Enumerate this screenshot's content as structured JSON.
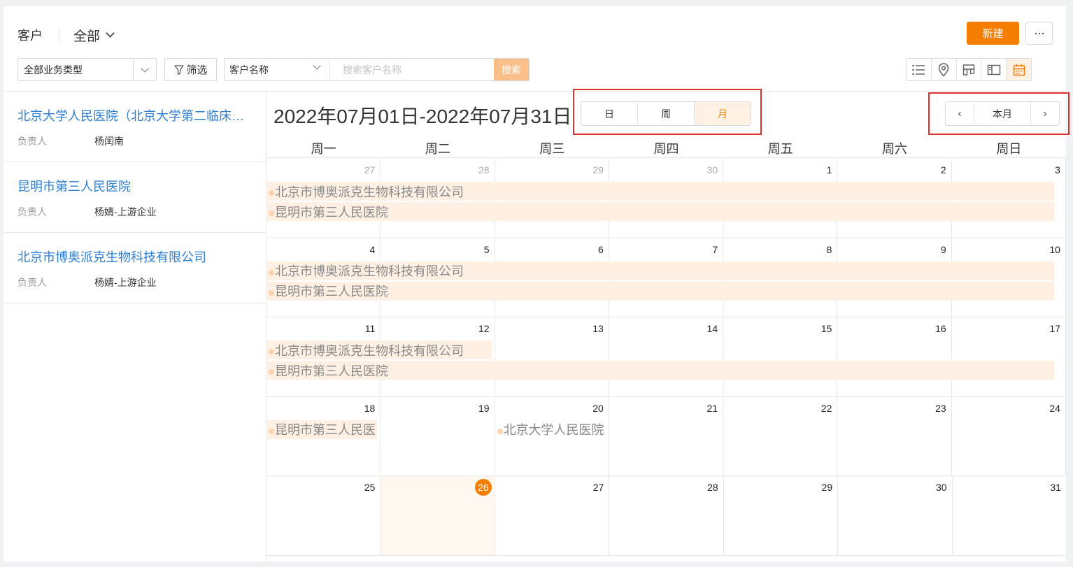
{
  "header": {
    "title": "客户",
    "scope": "全部",
    "new_label": "新建",
    "more_label": "···"
  },
  "filters": {
    "type_select": "全部业务类型",
    "filter_label": "筛选",
    "search_field": "客户名称",
    "search_placeholder": "搜索客户名称",
    "search_button": "搜索"
  },
  "view_switch": {
    "icons": [
      "list-icon",
      "map-pin-icon",
      "kanban-icon",
      "split-view-icon",
      "calendar-icon"
    ],
    "active": "calendar-icon"
  },
  "customers": [
    {
      "name": "北京大学人民医院（北京大学第二临床医学院）",
      "owner_label": "负责人",
      "owner": "杨闰南"
    },
    {
      "name": "昆明市第三人民医院",
      "owner_label": "负责人",
      "owner": "杨婧-上游企业"
    },
    {
      "name": "北京市博奥派克生物科技有限公司",
      "owner_label": "负责人",
      "owner": "杨婧-上游企业"
    }
  ],
  "calendar": {
    "range_title": "2022年07月01日-2022年07月31日",
    "modes": [
      "日",
      "周",
      "月"
    ],
    "active_mode": "月",
    "nav": {
      "prev": "‹",
      "current": "本月",
      "next": "›"
    },
    "weekdays": [
      "周一",
      "周二",
      "周三",
      "周四",
      "周五",
      "周六",
      "周日"
    ],
    "weeks": [
      [
        {
          "d": "27",
          "other": true
        },
        {
          "d": "28",
          "other": true
        },
        {
          "d": "29",
          "other": true
        },
        {
          "d": "30",
          "other": true
        },
        {
          "d": "1"
        },
        {
          "d": "2"
        },
        {
          "d": "3"
        }
      ],
      [
        {
          "d": "4"
        },
        {
          "d": "5"
        },
        {
          "d": "6"
        },
        {
          "d": "7"
        },
        {
          "d": "8"
        },
        {
          "d": "9"
        },
        {
          "d": "10"
        }
      ],
      [
        {
          "d": "11"
        },
        {
          "d": "12"
        },
        {
          "d": "13"
        },
        {
          "d": "14"
        },
        {
          "d": "15"
        },
        {
          "d": "16"
        },
        {
          "d": "17"
        }
      ],
      [
        {
          "d": "18"
        },
        {
          "d": "19"
        },
        {
          "d": "20"
        },
        {
          "d": "21"
        },
        {
          "d": "22"
        },
        {
          "d": "23"
        },
        {
          "d": "24"
        }
      ],
      [
        {
          "d": "25"
        },
        {
          "d": "26",
          "today": true
        },
        {
          "d": "27"
        },
        {
          "d": "28"
        },
        {
          "d": "29"
        },
        {
          "d": "30"
        },
        {
          "d": "31"
        }
      ]
    ],
    "events": [
      {
        "week": 0,
        "row": 0,
        "start": 0,
        "span": 7,
        "label": "北京市博奥派克生物科技有限公司"
      },
      {
        "week": 0,
        "row": 1,
        "start": 0,
        "span": 7,
        "label": "昆明市第三人民医院"
      },
      {
        "week": 1,
        "row": 0,
        "start": 0,
        "span": 7,
        "label": "北京市博奥派克生物科技有限公司"
      },
      {
        "week": 1,
        "row": 1,
        "start": 0,
        "span": 7,
        "label": "昆明市第三人民医院"
      },
      {
        "week": 2,
        "row": 0,
        "start": 0,
        "span": 2,
        "label": "北京市博奥派克生物科技有限公司"
      },
      {
        "week": 2,
        "row": 1,
        "start": 0,
        "span": 7,
        "label": "昆明市第三人民医院"
      },
      {
        "week": 3,
        "row": 0,
        "start": 0,
        "span": 1,
        "label": "昆明市第三人民医"
      },
      {
        "week": 3,
        "row": 0,
        "start": 2,
        "span": 1,
        "label": "北京大学人民医院",
        "plain": true
      }
    ]
  }
}
